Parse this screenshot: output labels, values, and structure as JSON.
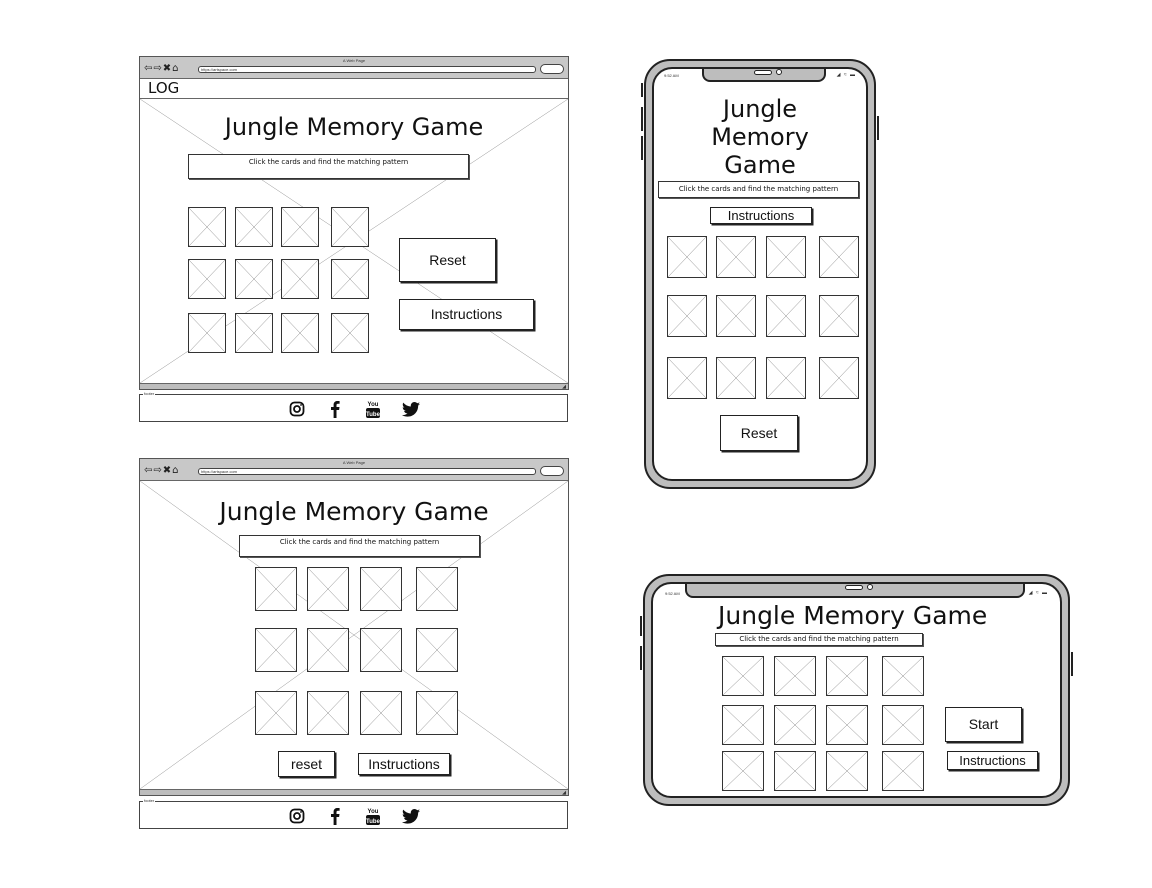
{
  "desktop_wireframe_1": {
    "window_title": "A Web Page",
    "url": "https://artspace.com",
    "logo": "LOG",
    "title": "Jungle Memory Game",
    "subtitle": "Click the cards and find the matching pattern",
    "buttons": {
      "reset": "Reset",
      "instructions": "Instructions"
    },
    "card_count": 12,
    "footer_label": "footer",
    "social_icons": [
      "instagram-icon",
      "facebook-icon",
      "youtube-icon",
      "twitter-icon"
    ]
  },
  "desktop_wireframe_2": {
    "window_title": "A Web Page",
    "url": "https://artspace.com",
    "title": "Jungle Memory Game",
    "subtitle": "Click the cards and find the matching pattern",
    "buttons": {
      "reset": "reset",
      "instructions": "Instructions"
    },
    "card_count": 12,
    "footer_label": "footer",
    "social_icons": [
      "instagram-icon",
      "facebook-icon",
      "youtube-icon",
      "twitter-icon"
    ]
  },
  "phone_portrait": {
    "status_time": "9:52 AM",
    "title_lines": [
      "Jungle",
      "Memory",
      "Game"
    ],
    "subtitle": "Click the cards and find the matching pattern",
    "buttons": {
      "instructions": "Instructions",
      "reset": "Reset"
    },
    "card_count": 12
  },
  "phone_landscape": {
    "status_time": "9:52 AM",
    "title": "Jungle Memory Game",
    "subtitle": "Click the cards and find the matching pattern",
    "buttons": {
      "start": "Start",
      "instructions": "Instructions"
    },
    "card_count": 12
  },
  "icons": {
    "youtube_top": "You",
    "youtube_bottom": "Tube"
  }
}
